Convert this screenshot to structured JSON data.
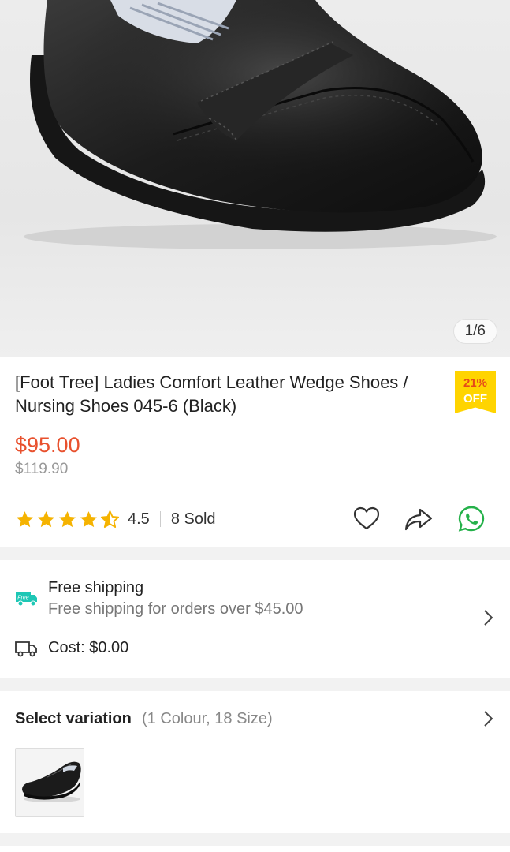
{
  "gallery": {
    "image_alt": "Black leather slip-on shoe",
    "counter": "1/6"
  },
  "product": {
    "title": "[Foot Tree] Ladies Comfort Leather Wedge Shoes / Nursing Shoes 045-6 (Black)",
    "discount_percent": "21%",
    "discount_word": "OFF",
    "price": "$95.00",
    "original_price": "$119.90",
    "rating": "4.5",
    "rating_fraction": 0.9,
    "sold": "8 Sold",
    "icons": [
      "star-icon",
      "heart-icon",
      "share-icon",
      "whatsapp-icon"
    ]
  },
  "shipping": {
    "badge": "Free",
    "title": "Free shipping",
    "subtitle": "Free shipping for orders over $45.00",
    "cost": "Cost: $0.00"
  },
  "variation": {
    "label": "Select variation",
    "detail": "(1 Colour, 18 Size)"
  },
  "colors": {
    "price": "#e8512e",
    "star": "#f5b301",
    "badge": "#ffd400",
    "whatsapp": "#25b14a",
    "ship_icon": "#1ec7b5"
  }
}
